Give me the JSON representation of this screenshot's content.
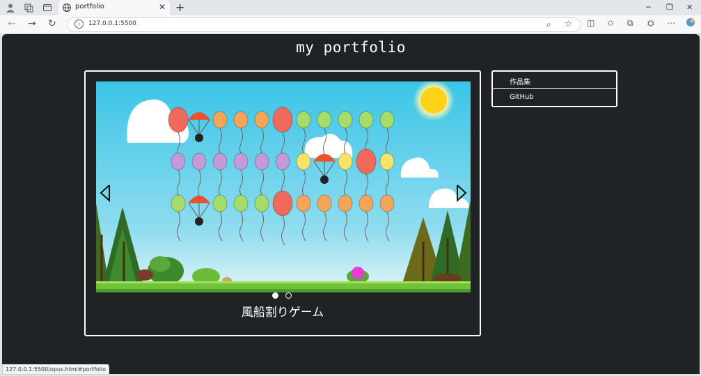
{
  "browser": {
    "tab_title": "portfolio",
    "url": "127.0.0.1:5500",
    "status_url": "127.0.0.1:5500/opus.html#portfolio"
  },
  "page": {
    "site_title": "my portfolio",
    "carousel": {
      "caption": "風船割りゲーム",
      "slide_count": 2,
      "active_slide": 1
    },
    "menu": [
      {
        "label": "作品集"
      },
      {
        "label": "GitHub"
      }
    ]
  },
  "colors": {
    "page_bg": "#202326",
    "sky_top": "#3cc6e6",
    "sky_bottom": "#cdeff6",
    "grass": "#6fc23a",
    "sun": "#ffd21a"
  }
}
